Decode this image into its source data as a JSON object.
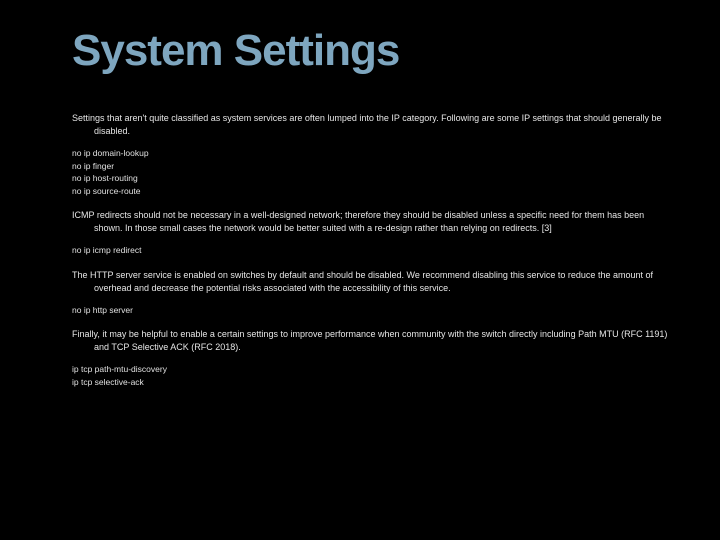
{
  "title": "System Settings",
  "para1": "Settings that aren't quite classified as system services are often lumped into the IP category.  Following are some IP settings that should generally be disabled.",
  "cmds1": [
    "no ip domain-lookup",
    "no ip finger",
    "no ip host-routing",
    "no ip source-route"
  ],
  "para2": "ICMP redirects should not be necessary in a well-designed network; therefore they should be disabled unless a specific need for them has been shown.  In those small cases the network would be better suited with a re-design rather than relying on redirects. [3]",
  "cmds2": [
    "no ip icmp redirect"
  ],
  "para3": "The HTTP server service is enabled on switches by default and should be disabled.  We recommend disabling this service to reduce the amount of overhead and decrease the potential risks associated with the accessibility of this service.",
  "cmds3": [
    "no ip http server"
  ],
  "para4": "Finally, it may be helpful to enable a certain settings to improve performance when community with the switch directly including Path MTU (RFC 1191) and TCP Selective ACK (RFC 2018).",
  "cmds4": [
    "ip tcp path-mtu-discovery",
    "ip tcp selective-ack"
  ]
}
